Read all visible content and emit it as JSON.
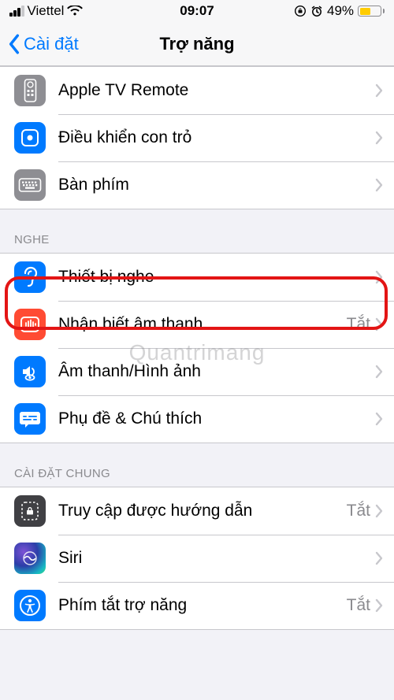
{
  "status": {
    "carrier": "Viettel",
    "time": "09:07",
    "battery_pct": "49%"
  },
  "nav": {
    "back_label": "Cài đặt",
    "title": "Trợ năng"
  },
  "section1": {
    "items": [
      {
        "label": "Apple TV Remote"
      },
      {
        "label": "Điều khiển con trỏ"
      },
      {
        "label": "Bàn phím"
      }
    ]
  },
  "section2": {
    "header": "NGHE",
    "items": [
      {
        "label": "Thiết bị nghe"
      },
      {
        "label": "Nhận biết âm thanh",
        "detail": "Tắt"
      },
      {
        "label": "Âm thanh/Hình ảnh"
      },
      {
        "label": "Phụ đề & Chú thích"
      }
    ]
  },
  "section3": {
    "header": "CÀI ĐẶT CHUNG",
    "items": [
      {
        "label": "Truy cập được hướng dẫn",
        "detail": "Tắt"
      },
      {
        "label": "Siri"
      },
      {
        "label": "Phím tắt trợ năng",
        "detail": "Tắt"
      }
    ]
  },
  "watermark": "Quantrimang"
}
